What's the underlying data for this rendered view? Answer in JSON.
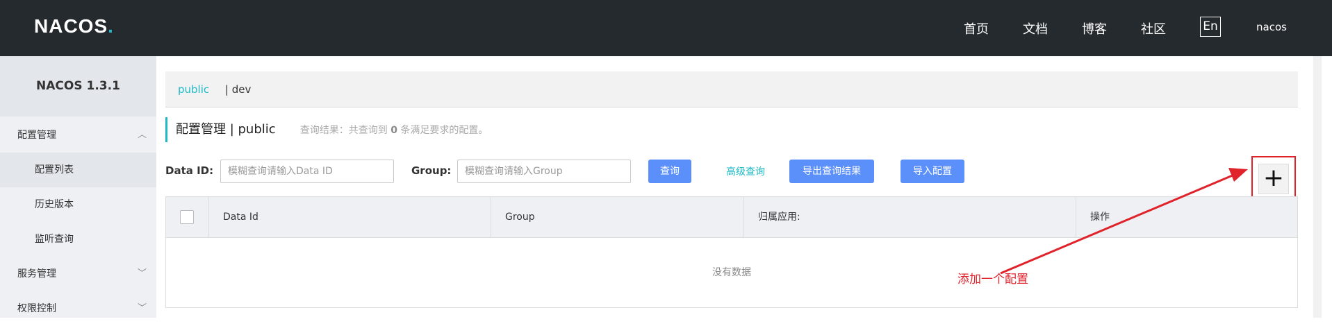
{
  "header": {
    "logo_text": "NACOS",
    "logo_dot": ".",
    "nav": [
      "首页",
      "文档",
      "博客",
      "社区"
    ],
    "lang": "En",
    "user": "nacos"
  },
  "sidebar": {
    "version": "NACOS 1.3.1",
    "items": [
      {
        "label": "配置管理",
        "chevron": "︿"
      },
      {
        "label": "配置列表"
      },
      {
        "label": "历史版本"
      },
      {
        "label": "监听查询"
      },
      {
        "label": "服务管理",
        "chevron": "﹀"
      },
      {
        "label": "权限控制",
        "chevron": "﹀"
      }
    ]
  },
  "namespaces": {
    "active": "public",
    "other": "| dev"
  },
  "page": {
    "title": "配置管理  |  public",
    "summary_prefix": "查询结果：共查询到",
    "summary_count": "0",
    "summary_suffix": "条满足要求的配置。"
  },
  "search": {
    "dataid_label": "Data ID:",
    "dataid_placeholder": "模糊查询请输入Data ID",
    "group_label": "Group:",
    "group_placeholder": "模糊查询请输入Group",
    "query_button": "查询",
    "advanced_link": "高级查询",
    "export_button": "导出查询结果",
    "import_button": "导入配置",
    "add_button": "+"
  },
  "table": {
    "columns": [
      "Data Id",
      "Group",
      "归属应用:",
      "操作"
    ],
    "empty_text": "没有数据"
  },
  "annotation": {
    "text": "添加一个配置",
    "color": "#e0222a"
  },
  "colors": {
    "topbar": "#252a2f",
    "accent": "#1fb8c4",
    "button": "#5b8ff9"
  }
}
